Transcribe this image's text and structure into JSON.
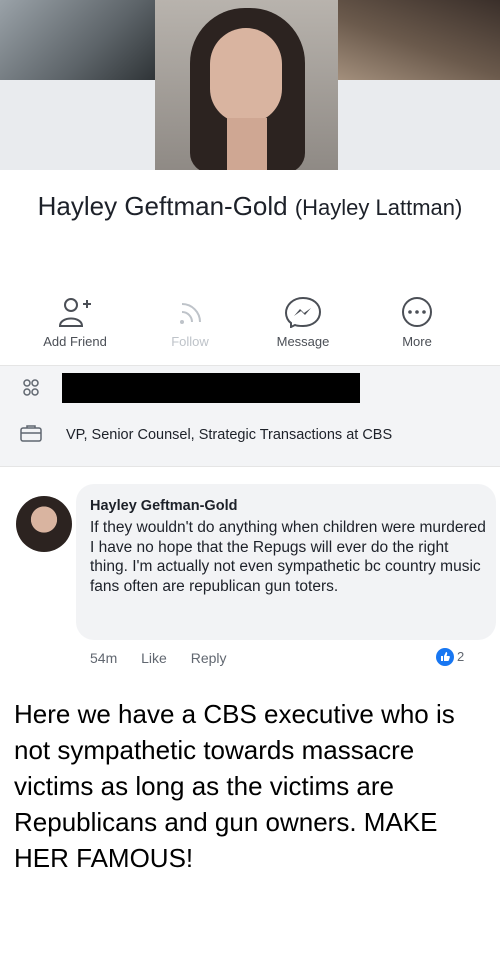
{
  "profile": {
    "name": "Hayley Geftman-Gold",
    "alternate_name": "(Hayley Lattman)"
  },
  "actions": [
    {
      "label": "Add Friend",
      "icon": "add-friend-icon",
      "enabled": true
    },
    {
      "label": "Follow",
      "icon": "follow-icon",
      "enabled": false
    },
    {
      "label": "Message",
      "icon": "messenger-icon",
      "enabled": true
    },
    {
      "label": "More",
      "icon": "more-icon",
      "enabled": true
    }
  ],
  "info": {
    "friends_icon": "friends-icon",
    "work_icon": "briefcase-icon",
    "work": "VP, Senior Counsel, Strategic Transactions at CBS"
  },
  "comment": {
    "author": "Hayley Geftman-Gold",
    "text": "If they wouldn't do anything when children were murdered I have no hope that the Repugs will ever do the right thing.  I'm actually not even sympathetic bc country music fans often are republican gun toters.",
    "time": "54m",
    "like_label": "Like",
    "reply_label": "Reply",
    "reaction_count": "2"
  },
  "caption": "Here we have a CBS executive who is not sympathetic towards massacre victims as long as the victims are Republicans and gun owners. MAKE HER FAMOUS!",
  "colors": {
    "accent": "#1877f2",
    "text": "#1d2129",
    "muted": "#616770"
  }
}
